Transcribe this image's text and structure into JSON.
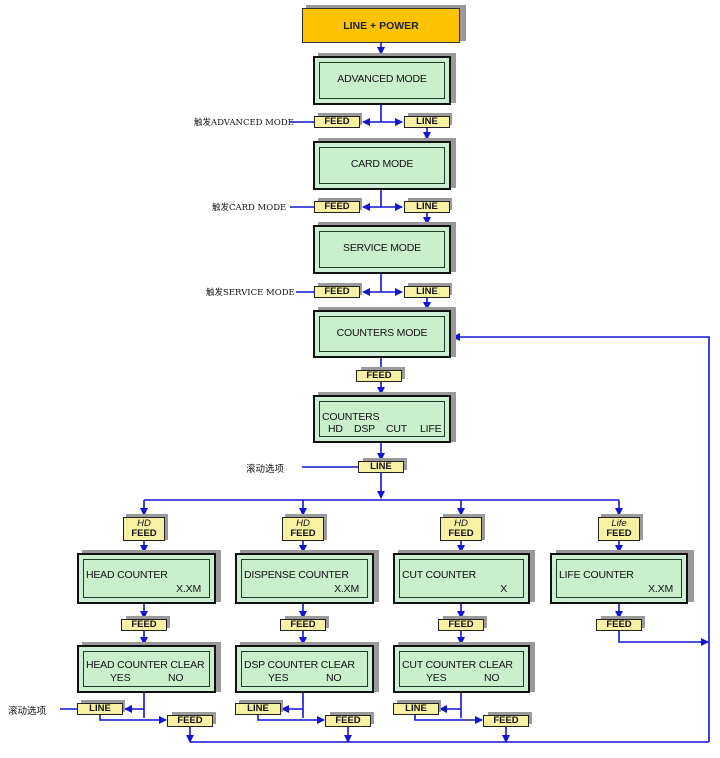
{
  "start": {
    "label": "LINE + POWER"
  },
  "modes": [
    {
      "title": "ADVANCED MODE",
      "trigger_label": "触发ADVANCED MODE"
    },
    {
      "title": "CARD MODE",
      "trigger_label": "触发CARD MODE"
    },
    {
      "title": "SERVICE MODE",
      "trigger_label": "触发SERVICE MODE"
    },
    {
      "title": "COUNTERS MODE"
    }
  ],
  "keys": {
    "feed": "FEED",
    "line": "LINE"
  },
  "counters_menu": {
    "title": "COUNTERS",
    "options": [
      "HD",
      "DSP",
      "CUT",
      "LIFE"
    ],
    "scroll_label": "滚动选项"
  },
  "columns": [
    {
      "entry_key_top": "HD",
      "entry_key_bottom": "FEED",
      "counter_title": "HEAD COUNTER",
      "counter_value": "X.XM",
      "clear_title": "HEAD COUNTER CLEAR",
      "yes": "YES",
      "no": "NO"
    },
    {
      "entry_key_top": "HD",
      "entry_key_bottom": "FEED",
      "counter_title": "DISPENSE COUNTER",
      "counter_value": "X.XM",
      "clear_title": "DSP COUNTER CLEAR",
      "yes": "YES",
      "no": "NO"
    },
    {
      "entry_key_top": "HD",
      "entry_key_bottom": "FEED",
      "counter_title": "CUT COUNTER",
      "counter_value": "X",
      "clear_title": "CUT COUNTER CLEAR",
      "yes": "YES",
      "no": "NO"
    },
    {
      "entry_key_top": "Life",
      "entry_key_bottom": "FEED",
      "counter_title": "LIFE COUNTER",
      "counter_value": "X.XM"
    }
  ],
  "bottom_scroll_label": "滚动选项",
  "colors": {
    "wire": "#1414d2",
    "lcd": "#c9f0cb",
    "key": "#f7f1a3",
    "power": "#fdc300",
    "shadow": "#9a9a9a"
  }
}
